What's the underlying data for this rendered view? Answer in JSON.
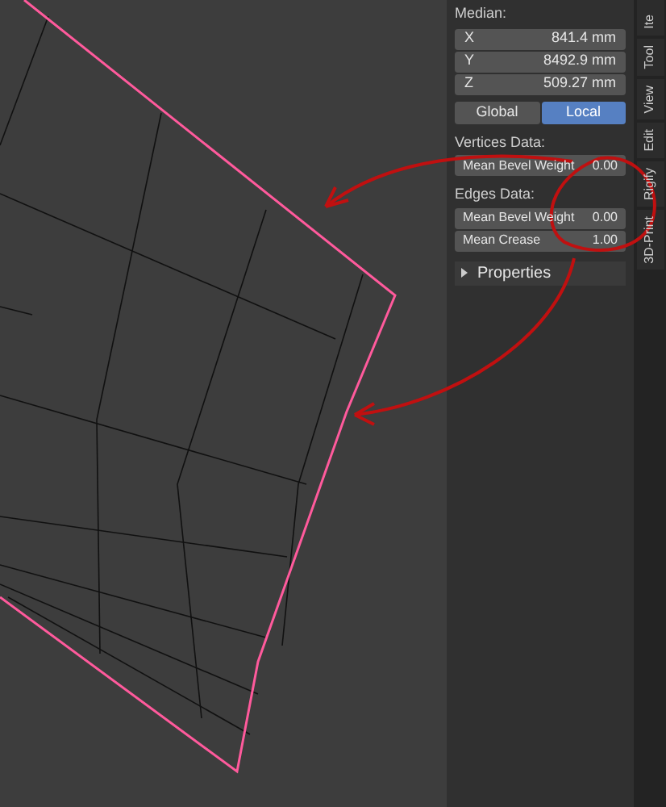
{
  "sidebar": {
    "median": {
      "label": "Median:",
      "coords": [
        {
          "axis": "X",
          "value": "841.4 mm"
        },
        {
          "axis": "Y",
          "value": "8492.9 mm"
        },
        {
          "axis": "Z",
          "value": "509.27 mm"
        }
      ]
    },
    "orientation": [
      {
        "label": "Global",
        "selected": false
      },
      {
        "label": "Local",
        "selected": true
      }
    ],
    "sections": [
      {
        "title": "Vertices Data:",
        "fields": [
          {
            "label": "Mean Bevel Weight",
            "value": "0.00"
          }
        ]
      },
      {
        "title": "Edges Data:",
        "fields": [
          {
            "label": "Mean Bevel Weight",
            "value": "0.00"
          },
          {
            "label": "Mean Crease",
            "value": "1.00"
          }
        ]
      }
    ],
    "properties": {
      "label": "Properties",
      "expanded": false
    }
  },
  "tabs": [
    {
      "label": "Ite"
    },
    {
      "label": "Tool"
    },
    {
      "label": "View"
    },
    {
      "label": "Edit"
    },
    {
      "label": "Rigify"
    },
    {
      "label": "3D-Print"
    }
  ]
}
